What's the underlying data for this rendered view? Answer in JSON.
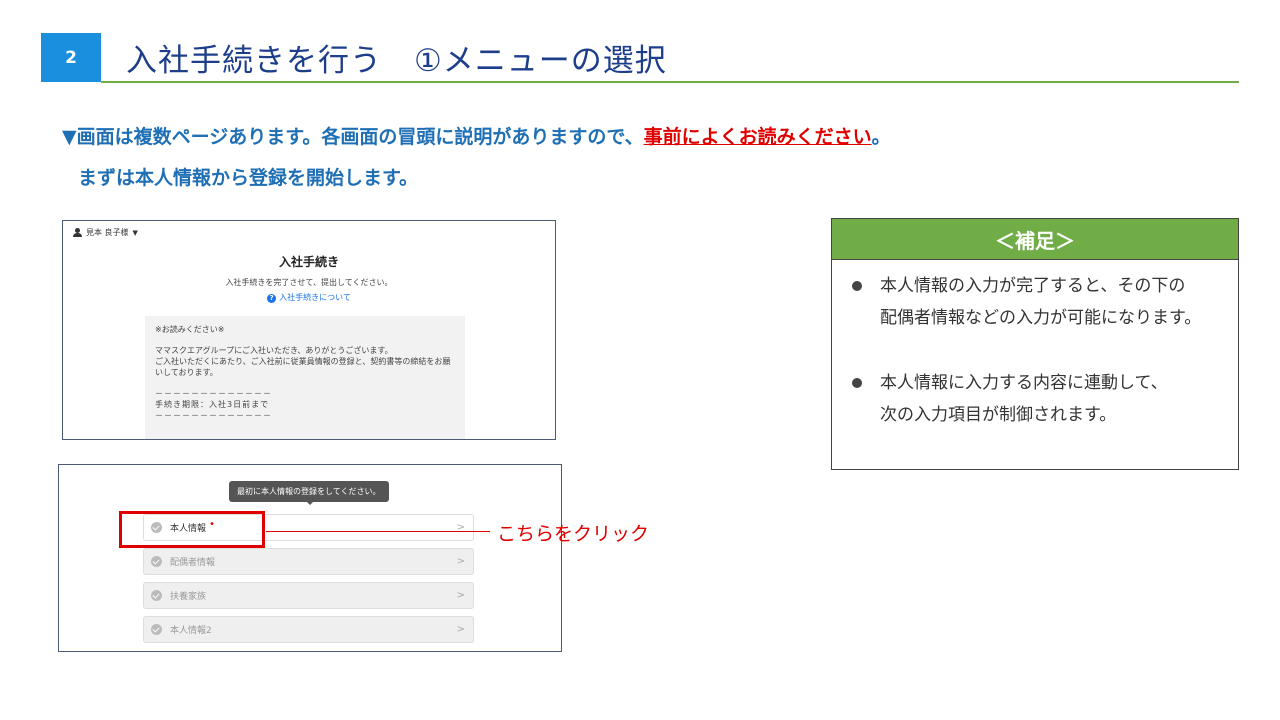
{
  "header": {
    "step_number": "2",
    "title": "入社手続きを行う　①メニューの選択"
  },
  "instructions": {
    "line1_prefix": "▼画面は複数ページあります。各画面の冒頭に説明がありますので、",
    "line1_emphasis": "事前によくお読みください",
    "line1_suffix": "。",
    "line2": "まずは本人情報から登録を開始します。"
  },
  "screenshot1": {
    "user_name": "見本 良子様",
    "caret": "▼",
    "title": "入社手続き",
    "subtitle": "入社手続きを完了させて、提出してください。",
    "help_link": "入社手続きについて",
    "notice": {
      "heading": "※お読みください※",
      "body1": "ママスクエアグループにご入社いただき、ありがとうございます。",
      "body2": "ご入社いただくにあたり、ご入社前に従業員情報の登録と、契約書等の締結をお願いしております。",
      "dash1": "－－－－－－－－－－－－－",
      "deadline": "手続き期限：入社3日前まで",
      "dash2": "－－－－－－－－－－－－－"
    }
  },
  "screenshot2": {
    "tooltip": "最初に本人情報の登録をしてください。",
    "menu_items": [
      {
        "label": "本人情報",
        "required_mark": "•",
        "chevron": ">"
      },
      {
        "label": "配偶者情報",
        "chevron": ">"
      },
      {
        "label": "扶養家族",
        "chevron": ">"
      },
      {
        "label": "本人情報2",
        "chevron": ">"
      }
    ]
  },
  "callout": {
    "text": "こちらをクリック"
  },
  "supplement": {
    "heading": "＜補足＞",
    "items": [
      {
        "line1": "本人情報の入力が完了すると、その下の",
        "line2": "配偶者情報などの入力が可能になります。"
      },
      {
        "line1": "本人情報に入力する内容に連動して、",
        "line2": "次の入力項目が制御されます。"
      }
    ]
  },
  "colors": {
    "badge_blue": "#1a8fdd",
    "title_navy": "#1d3e8a",
    "accent_green": "#70ad47",
    "instruction_blue": "#1f6fb5",
    "emphasis_red": "#e00000"
  }
}
